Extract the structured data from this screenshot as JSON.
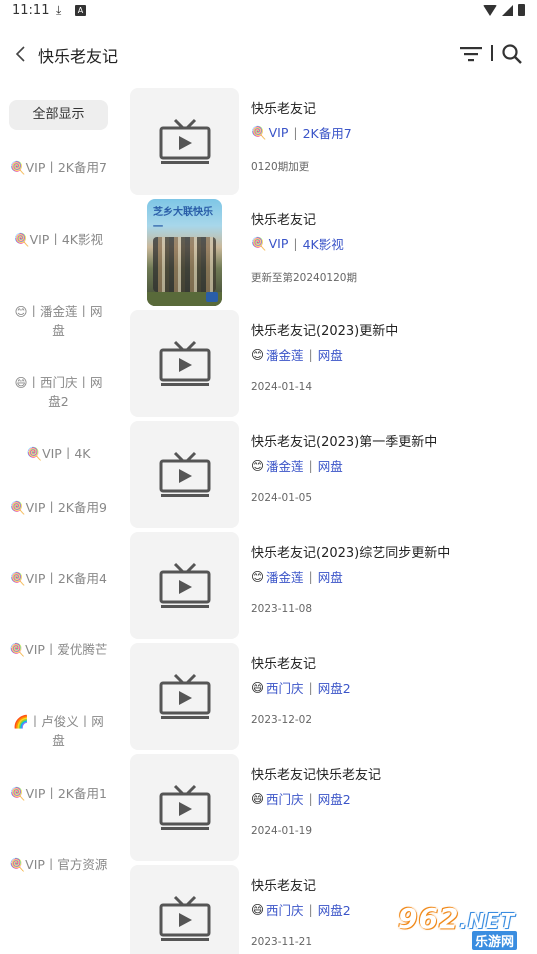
{
  "status": {
    "time": "11:11",
    "download_icon": "download-icon",
    "a_icon": "A"
  },
  "header": {
    "title": "快乐老友记",
    "back_icon": "chevron-left-icon",
    "filter_icon": "filter-icon",
    "search_icon": "search-icon"
  },
  "sidebar": {
    "items": [
      {
        "label": "全部显示",
        "active": true
      },
      {
        "label": "🍭VIP丨2K备用7"
      },
      {
        "label": "🍭VIP丨4K影视"
      },
      {
        "label": "😊丨潘金莲丨网盘"
      },
      {
        "label": "😄丨西门庆丨网盘2"
      },
      {
        "label": "🍭VIP丨4K"
      },
      {
        "label": "🍭VIP丨2K备用9"
      },
      {
        "label": "🍭VIP丨2K备用4"
      },
      {
        "label": "🍭VIP丨爱优腾芒"
      },
      {
        "label": "🌈丨卢俊义丨网盘"
      },
      {
        "label": "🍭VIP丨2K备用1"
      },
      {
        "label": "🍭VIP丨官方资源"
      }
    ]
  },
  "results": [
    {
      "name": "快乐老友记",
      "emoji": "🍭",
      "src1": "VIP",
      "src2": "2K备用7",
      "note": "0120期加更",
      "thumb": "tv-placeholder"
    },
    {
      "name": "快乐老友记",
      "emoji": "🍭",
      "src1": "VIP",
      "src2": "4K影视",
      "note": "更新至第20240120期",
      "thumb": "poster",
      "poster_text": "芝乡大联快乐一"
    },
    {
      "name": "快乐老友记(2023)更新中",
      "emoji": "😊",
      "src1": "潘金莲",
      "src2": "网盘",
      "note": "2024-01-14",
      "thumb": "tv-placeholder"
    },
    {
      "name": "快乐老友记(2023)第一季更新中",
      "emoji": "😊",
      "src1": "潘金莲",
      "src2": "网盘",
      "note": "2024-01-05",
      "thumb": "tv-placeholder"
    },
    {
      "name": "快乐老友记(2023)综艺同步更新中",
      "emoji": "😊",
      "src1": "潘金莲",
      "src2": "网盘",
      "note": "2023-11-08",
      "thumb": "tv-placeholder"
    },
    {
      "name": "快乐老友记",
      "emoji": "😄",
      "src1": "西门庆",
      "src2": "网盘2",
      "note": "2023-12-02",
      "thumb": "tv-placeholder"
    },
    {
      "name": "快乐老友记快乐老友记",
      "emoji": "😄",
      "src1": "西门庆",
      "src2": "网盘2",
      "note": "2024-01-19",
      "thumb": "tv-placeholder"
    },
    {
      "name": "快乐老友记",
      "emoji": "😄",
      "src1": "西门庆",
      "src2": "网盘2",
      "note": "2023-11-21",
      "thumb": "tv-placeholder"
    }
  ],
  "watermark": {
    "big": "962",
    "net": ".NET",
    "small": "乐游网"
  },
  "colors": {
    "accent": "#3a54c8",
    "thumb_bg": "#f3f3f3",
    "active_bg": "#eeeeee"
  }
}
